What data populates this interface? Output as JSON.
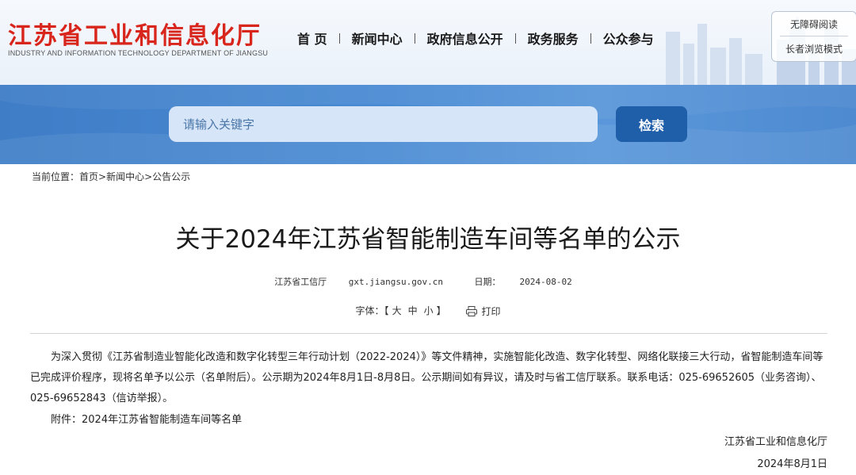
{
  "header": {
    "logo_cn": "江苏省工业和信息化厅",
    "logo_en": "INDUSTRY AND INFORMATION TECHNOLOGY DEPARTMENT OF JIANGSU",
    "nav": [
      {
        "label": "首 页"
      },
      {
        "label": "新闻中心"
      },
      {
        "label": "政府信息公开"
      },
      {
        "label": "政务服务"
      },
      {
        "label": "公众参与"
      }
    ],
    "accessibility": {
      "barrier_free": "无障碍阅读",
      "elder_mode": "长者浏览模式"
    }
  },
  "search": {
    "placeholder": "请输入关键字",
    "button_label": "检索"
  },
  "breadcrumb": {
    "prefix": "当前位置：",
    "items": [
      "首页",
      "新闻中心",
      "公告公示"
    ],
    "separator": ">"
  },
  "article": {
    "title": "关于2024年江苏省智能制造车间等名单的公示",
    "source": "江苏省工信厅",
    "site": "gxt.jiangsu.gov.cn",
    "date_label": "日期：",
    "date": "2024-08-02",
    "font_label": "字体：",
    "font_open": "【",
    "font_sizes": [
      "大",
      "中",
      "小"
    ],
    "font_close": "】",
    "print_label": "打印",
    "paragraph": "为深入贯彻《江苏省制造业智能化改造和数字化转型三年行动计划（2022-2024）》等文件精神，实施智能化改造、数字化转型、网络化联接三大行动，省智能制造车间等已完成评价程序，现将名单予以公示（名单附后）。公示期为2024年8月1日-8月8日。公示期间如有异议，请及时与省工信厅联系。联系电话：025-69652605（业务咨询）、025-69652843（信访举报）。",
    "attachment": "附件：2024年江苏省智能制造车间等名单",
    "signature_org": "江苏省工业和信息化厅",
    "signature_date": "2024年8月1日"
  },
  "colors": {
    "logo_red": "#d9261c",
    "banner_blue": "#4a8bd3",
    "button_blue": "#1f5ea8",
    "input_bg": "#d6e5f7"
  }
}
